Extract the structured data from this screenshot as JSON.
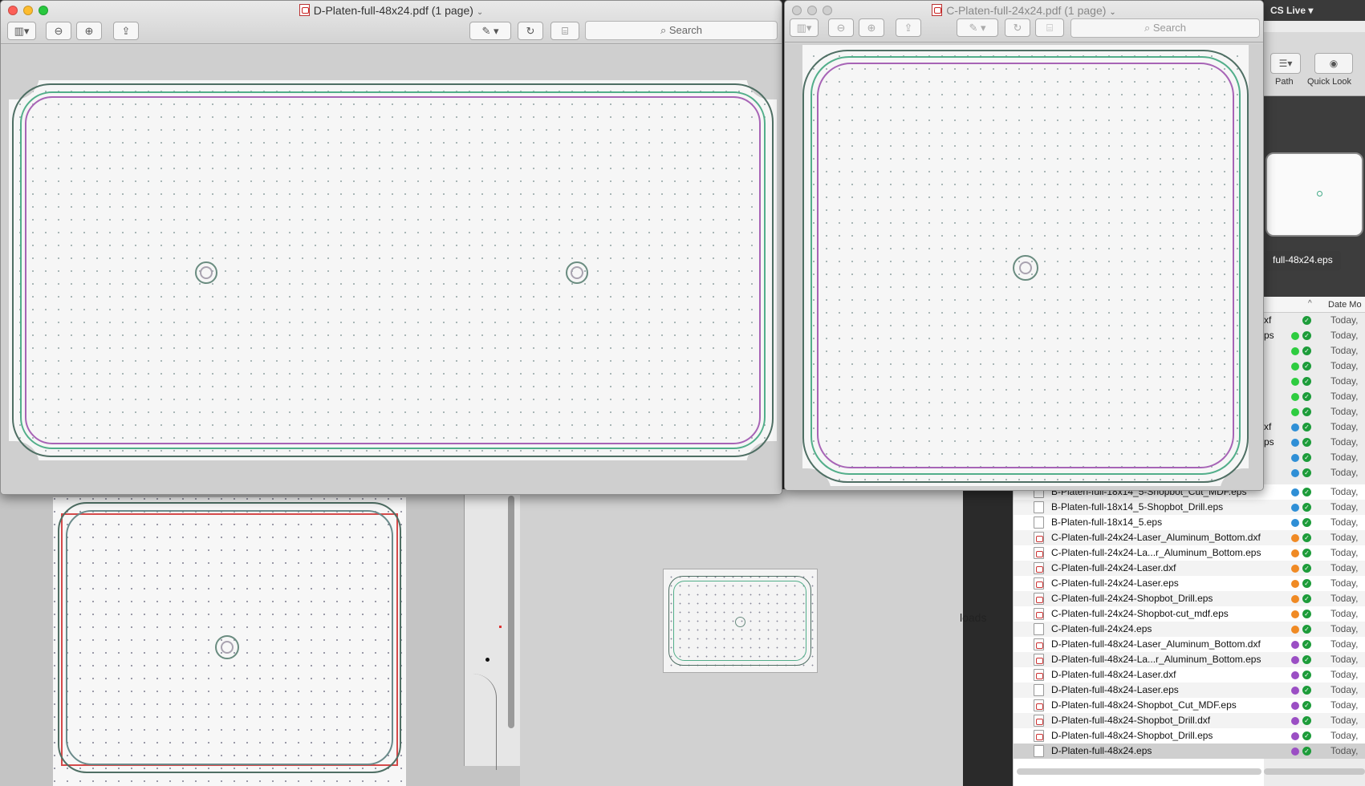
{
  "windows": {
    "d_platen": {
      "title": "D-Platen-full-48x24.pdf (1 page)",
      "search_placeholder": "Search"
    },
    "c_platen": {
      "title": "C-Platen-full-24x24.pdf (1 page)",
      "search_placeholder": "Search"
    }
  },
  "finder": {
    "menubar_label": "CS Live ▾",
    "toolbar": {
      "path_label": "Path",
      "quicklook_label": "Quick Look"
    },
    "preview_filename": "full-48x24.eps",
    "column_header_date": "Date Mo",
    "loads_label": "loads",
    "partial_rows": [
      {
        "frag": "xf",
        "tag": "",
        "date": "Today, "
      },
      {
        "frag": "ps",
        "tag": "#2ecc40",
        "date": "Today, "
      },
      {
        "frag": "",
        "tag": "#2ecc40",
        "date": "Today, "
      },
      {
        "frag": "",
        "tag": "#2ecc40",
        "date": "Today, "
      },
      {
        "frag": "",
        "tag": "#2ecc40",
        "date": "Today, "
      },
      {
        "frag": "",
        "tag": "#2ecc40",
        "date": "Today, "
      },
      {
        "frag": "",
        "tag": "#2ecc40",
        "date": "Today, "
      },
      {
        "frag": "xf",
        "tag": "#2f8fd6",
        "date": "Today, "
      },
      {
        "frag": "ps",
        "tag": "#2f8fd6",
        "date": "Today, "
      },
      {
        "frag": "",
        "tag": "#2f8fd6",
        "date": "Today, "
      },
      {
        "frag": "",
        "tag": "#2f8fd6",
        "date": "Today, "
      }
    ],
    "files": [
      {
        "name": "B-Platen-full-18x14_5-Shopbot_Cut_MDF.eps",
        "type": "eps",
        "tag": "#2f8fd6",
        "date": "Today, "
      },
      {
        "name": "B-Platen-full-18x14_5-Shopbot_Drill.eps",
        "type": "eps",
        "tag": "#2f8fd6",
        "date": "Today, "
      },
      {
        "name": "B-Platen-full-18x14_5.eps",
        "type": "eps",
        "tag": "#2f8fd6",
        "date": "Today, "
      },
      {
        "name": "C-Platen-full-24x24-Laser_Aluminum_Bottom.dxf",
        "type": "pdf",
        "tag": "#f08a24",
        "date": "Today, "
      },
      {
        "name": "C-Platen-full-24x24-La...r_Aluminum_Bottom.eps",
        "type": "pdf",
        "tag": "#f08a24",
        "date": "Today, "
      },
      {
        "name": "C-Platen-full-24x24-Laser.dxf",
        "type": "pdf",
        "tag": "#f08a24",
        "date": "Today, "
      },
      {
        "name": "C-Platen-full-24x24-Laser.eps",
        "type": "pdf",
        "tag": "#f08a24",
        "date": "Today, "
      },
      {
        "name": "C-Platen-full-24x24-Shopbot_Drill.eps",
        "type": "pdf",
        "tag": "#f08a24",
        "date": "Today, "
      },
      {
        "name": "C-Platen-full-24x24-Shopbot-cut_mdf.eps",
        "type": "pdf",
        "tag": "#f08a24",
        "date": "Today, "
      },
      {
        "name": "C-Platen-full-24x24.eps",
        "type": "eps",
        "tag": "#f08a24",
        "date": "Today, "
      },
      {
        "name": "D-Platen-full-48x24-Laser_Aluminum_Bottom.dxf",
        "type": "pdf",
        "tag": "#9b4fc4",
        "date": "Today, "
      },
      {
        "name": "D-Platen-full-48x24-La...r_Aluminum_Bottom.eps",
        "type": "pdf",
        "tag": "#9b4fc4",
        "date": "Today, "
      },
      {
        "name": "D-Platen-full-48x24-Laser.dxf",
        "type": "pdf",
        "tag": "#9b4fc4",
        "date": "Today, "
      },
      {
        "name": "D-Platen-full-48x24-Laser.eps",
        "type": "eps",
        "tag": "#9b4fc4",
        "date": "Today, "
      },
      {
        "name": "D-Platen-full-48x24-Shopbot_Cut_MDF.eps",
        "type": "pdf",
        "tag": "#9b4fc4",
        "date": "Today, "
      },
      {
        "name": "D-Platen-full-48x24-Shopbot_Drill.dxf",
        "type": "pdf",
        "tag": "#9b4fc4",
        "date": "Today, "
      },
      {
        "name": "D-Platen-full-48x24-Shopbot_Drill.eps",
        "type": "pdf",
        "tag": "#9b4fc4",
        "date": "Today, "
      },
      {
        "name": "D-Platen-full-48x24.eps",
        "type": "eps",
        "tag": "#9b4fc4",
        "date": "Today, "
      }
    ]
  },
  "colors": {
    "tag_green": "#2ecc40",
    "tag_blue": "#2f8fd6",
    "tag_orange": "#f08a24",
    "tag_purple": "#9b4fc4",
    "outline_teal": "#52ae8a",
    "outline_magenta": "#a764b6"
  },
  "icons": {
    "sidebar": "sidebar-toggle-icon",
    "zoom_out": "zoom-out-icon",
    "zoom_in": "zoom-in-icon",
    "share": "share-icon",
    "markup": "markup-pen-icon",
    "rotate": "rotate-icon",
    "toolbox": "toolbox-icon",
    "search": "search-icon",
    "quicklook": "eye-icon"
  }
}
